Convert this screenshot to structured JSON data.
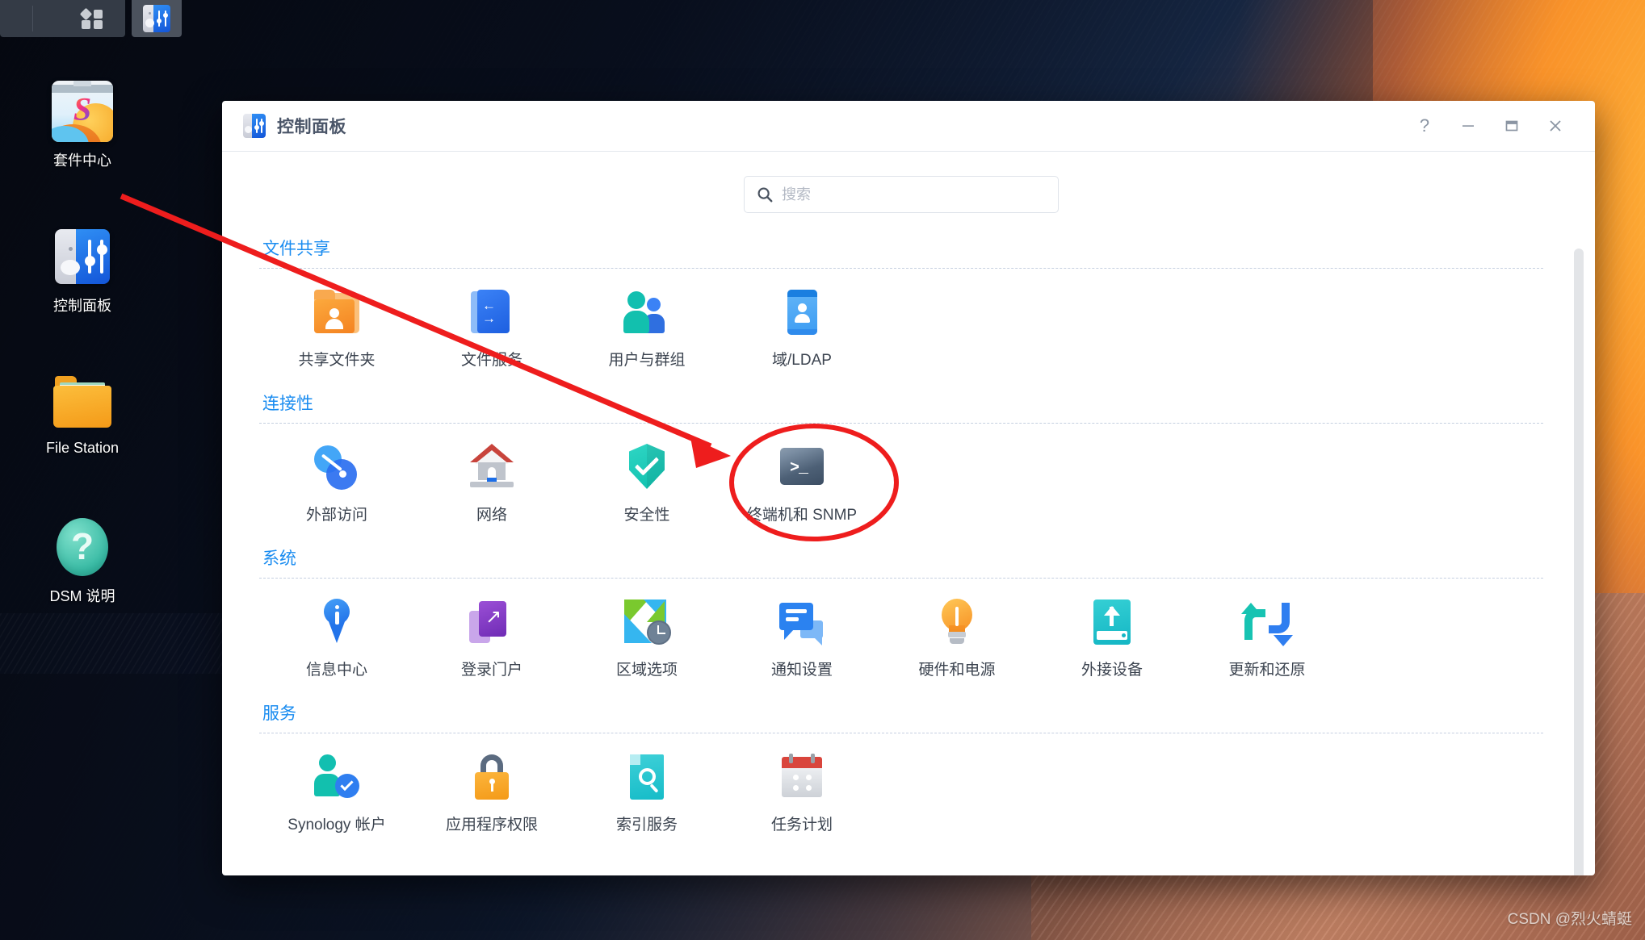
{
  "taskbar": {
    "apps_menu_icon": "grid-apps-icon",
    "open_app_icon": "control-panel-icon"
  },
  "desktop": {
    "icons": [
      {
        "label": "套件中心",
        "icon": "package-center-icon"
      },
      {
        "label": "控制面板",
        "icon": "control-panel-icon"
      },
      {
        "label": "File Station",
        "icon": "folder-icon"
      },
      {
        "label": "DSM 说明",
        "icon": "question-mark-icon"
      }
    ]
  },
  "window": {
    "title": "控制面板",
    "title_icon": "control-panel-icon",
    "buttons": {
      "help": "?",
      "minimize": "minimize-icon",
      "maximize": "maximize-icon",
      "close": "close-icon"
    }
  },
  "search": {
    "placeholder": "搜索",
    "value": "",
    "icon": "search-icon"
  },
  "sections": [
    {
      "title": "文件共享",
      "items": [
        {
          "label": "共享文件夹",
          "icon": "shared-folder-icon"
        },
        {
          "label": "文件服务",
          "icon": "file-services-icon"
        },
        {
          "label": "用户与群组",
          "icon": "users-groups-icon"
        },
        {
          "label": "域/LDAP",
          "icon": "domain-ldap-icon"
        }
      ]
    },
    {
      "title": "连接性",
      "items": [
        {
          "label": "外部访问",
          "icon": "external-access-icon"
        },
        {
          "label": "网络",
          "icon": "network-icon"
        },
        {
          "label": "安全性",
          "icon": "security-shield-icon"
        },
        {
          "label": "终端机和 SNMP",
          "icon": "terminal-snmp-icon"
        }
      ]
    },
    {
      "title": "系统",
      "items": [
        {
          "label": "信息中心",
          "icon": "info-center-icon"
        },
        {
          "label": "登录门户",
          "icon": "login-portal-icon"
        },
        {
          "label": "区域选项",
          "icon": "regional-options-icon"
        },
        {
          "label": "通知设置",
          "icon": "notification-icon"
        },
        {
          "label": "硬件和电源",
          "icon": "hardware-power-icon"
        },
        {
          "label": "外接设备",
          "icon": "external-devices-icon"
        },
        {
          "label": "更新和还原",
          "icon": "update-restore-icon"
        }
      ]
    },
    {
      "title": "服务",
      "items": [
        {
          "label": "Synology 帐户",
          "icon": "synology-account-icon"
        },
        {
          "label": "应用程序权限",
          "icon": "app-privileges-icon"
        },
        {
          "label": "索引服务",
          "icon": "indexing-service-icon"
        },
        {
          "label": "任务计划",
          "icon": "task-scheduler-icon"
        }
      ]
    }
  ],
  "annotations": {
    "highlight_color": "#ee1d1d",
    "arrow": "red-arrow-pointing-to-terminal-snmp",
    "ellipse": "red-ellipse-around-terminal-snmp"
  },
  "watermark": {
    "text": "CSDN @烈火蜻蜓"
  }
}
